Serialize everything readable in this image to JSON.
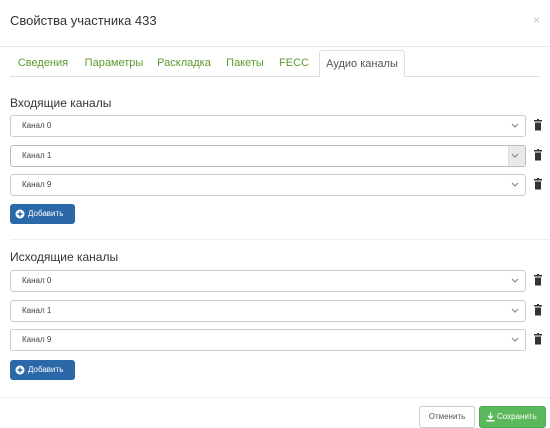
{
  "modal": {
    "title": "Свойства участника 433",
    "close": "×"
  },
  "tabs": [
    {
      "label": "Сведения"
    },
    {
      "label": "Параметры"
    },
    {
      "label": "Раскладка"
    },
    {
      "label": "Пакеты"
    },
    {
      "label": "FECC"
    },
    {
      "label": "Аудио каналы",
      "active": true
    }
  ],
  "incoming": {
    "title": "Входящие каналы",
    "channels": [
      {
        "value": "Канал 0"
      },
      {
        "value": "Канал 1",
        "focused": true
      },
      {
        "value": "Канал 9"
      }
    ],
    "add_label": "Добавить"
  },
  "outgoing": {
    "title": "Исходящие каналы",
    "channels": [
      {
        "value": "Канал 0"
      },
      {
        "value": "Канал 1"
      },
      {
        "value": "Канал 9"
      }
    ],
    "add_label": "Добавить"
  },
  "footer": {
    "cancel_label": "Отменить",
    "save_label": "Сохранить"
  },
  "colors": {
    "tab_link": "#5c9a2e",
    "add_button": "#2b68a7",
    "save_button": "#5cb85c"
  },
  "icons": {
    "select_arrow": "chevron-down-icon",
    "delete": "trash-icon",
    "add": "plus-circle-icon",
    "save": "download-icon",
    "close": "close-icon"
  }
}
